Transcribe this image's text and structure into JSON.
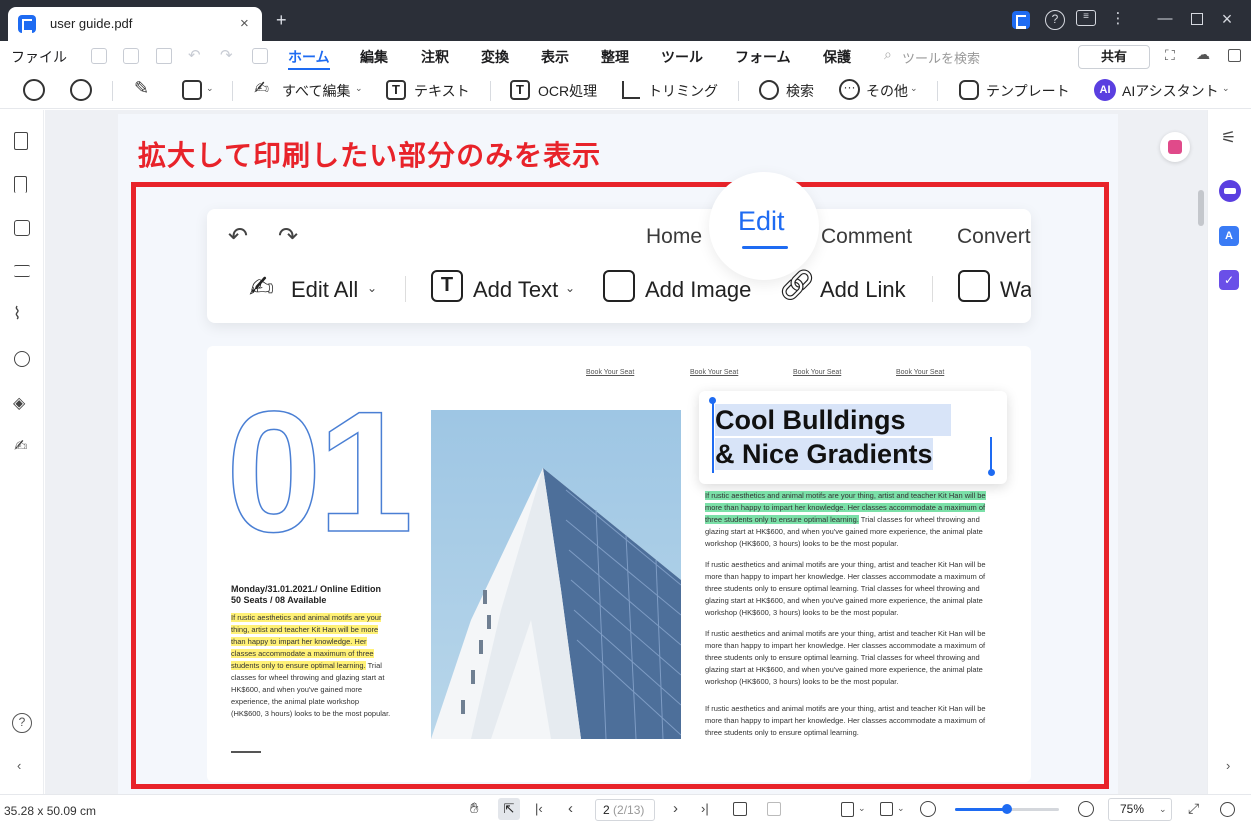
{
  "titlebar": {
    "tab_title": "user guide.pdf",
    "tab_close": "×",
    "new_tab": "+"
  },
  "menubar": {
    "file": "ファイル",
    "items": [
      "ホーム",
      "編集",
      "注釈",
      "変換",
      "表示",
      "整理",
      "ツール",
      "フォーム",
      "保護"
    ],
    "active": "ホーム",
    "search_placeholder": "ツールを検索",
    "share": "共有"
  },
  "toolbar": {
    "edit_all": "すべて編集",
    "text": "テキスト",
    "ocr": "OCR処理",
    "crop": "トリミング",
    "search": "検索",
    "more": "その他",
    "template": "テンプレート",
    "ai_badge": "AI",
    "ai_assistant": "AIアシスタント"
  },
  "document": {
    "headline": "拡大して印刷したい部分のみを表示",
    "mock_tabs": [
      "Home",
      "Edit",
      "Comment",
      "Convert"
    ],
    "mock_tools": [
      "Edit All",
      "Add Text",
      "Add Image",
      "Add Link",
      "Wa"
    ],
    "book_links": [
      "Book Your Seat",
      "Book Your Seat",
      "Book Your Seat",
      "Book Your Seat"
    ],
    "big_number": "01",
    "event_line1": "Monday/31.01.2021./ Online Edition",
    "event_line2": "50 Seats / 08 Available",
    "left_hl": [
      "If rustic aesthetics and animal motifs are your",
      "thing, artist and teacher Kit Han will be more",
      "than happy to impart her knowledge. Her",
      "classes accommodate a maximum of three",
      "students only to ensure optimal learning."
    ],
    "left_tail": [
      " Trial",
      "classes for wheel throwing and glazing start at",
      "HK$600, and when you've gained more",
      "experience, the animal plate workshop",
      "(HK$600, 3 hours) looks to be the most popular."
    ],
    "callout_line1": "Cool Bulldings",
    "callout_line2": "& Nice Gradients",
    "right_hl": [
      "If rustic aesthetics and animal motifs are your thing, artist and teacher Kit Han will be",
      "more than happy to impart her knowledge. Her classes accommodate a maximum of",
      "three students only to ensure optimal learning."
    ],
    "right_tail1": [
      " Trial classes for wheel throwing and",
      "glazing start at HK$600, and when you've gained more experience, the animal plate",
      "workshop (HK$600, 3 hours) looks to be the most popular."
    ],
    "right_p2": [
      "If rustic aesthetics and animal motifs are your thing, artist and teacher Kit Han will be",
      "more than happy to impart her knowledge. Her classes accommodate a maximum of",
      "three students only to ensure optimal learning. Trial classes for wheel throwing and",
      "glazing start at HK$600, and when you've gained more experience, the animal plate",
      "workshop (HK$600, 3 hours) looks to be the most popular."
    ],
    "right_p3": [
      "If rustic aesthetics and animal motifs are your thing, artist and teacher Kit Han will be",
      "more than happy to impart her knowledge. Her classes accommodate a maximum of",
      "three students only to ensure optimal learning. Trial classes for wheel throwing and",
      "glazing start at HK$600, and when you've gained more experience, the animal plate",
      "workshop (HK$600, 3 hours) looks to be the most popular."
    ],
    "right_p4": [
      "If rustic aesthetics and animal motifs are your thing, artist and teacher Kit Han will be",
      "more than happy to impart her knowledge. Her classes accommodate a maximum of",
      "three students only to ensure optimal learning."
    ]
  },
  "statusbar": {
    "page_size": "35.28 x 50.09 cm",
    "page_current": "2",
    "page_total": "(2/13)",
    "zoom": "75%",
    "zoom_level": 0.5
  },
  "colors": {
    "accent": "#1e6bf2",
    "annotation_red": "#e8232a",
    "highlight_yellow": "#fff176",
    "highlight_green": "#7be0a8"
  }
}
